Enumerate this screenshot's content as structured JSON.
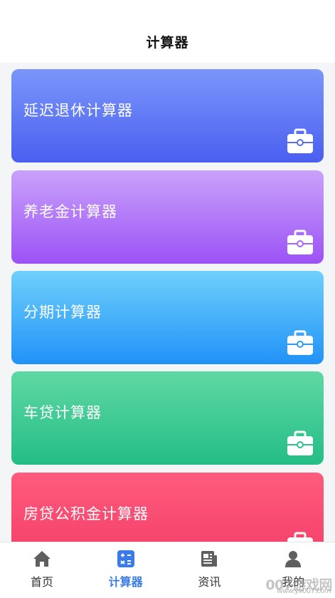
{
  "header": {
    "title": "计算器"
  },
  "cards": [
    {
      "label": "延迟退休计算器",
      "icon": "briefcase-icon"
    },
    {
      "label": "养老金计算器",
      "icon": "briefcase-icon"
    },
    {
      "label": "分期计算器",
      "icon": "briefcase-icon"
    },
    {
      "label": "车贷计算器",
      "icon": "briefcase-icon"
    },
    {
      "label": "房贷公积金计算器",
      "icon": "briefcase-icon"
    }
  ],
  "tabbar": {
    "tabs": [
      {
        "label": "首页",
        "icon": "home-icon",
        "active": false
      },
      {
        "label": "计算器",
        "icon": "calculator-icon",
        "active": true
      },
      {
        "label": "资讯",
        "icon": "news-icon",
        "active": false
      },
      {
        "label": "我的",
        "icon": "user-icon",
        "active": false
      }
    ]
  },
  "watermark": {
    "text": "007游戏网",
    "sub": "www.yx007.com"
  },
  "colors": {
    "accent": "#3a7be8",
    "inactive_icon": "#5f5f5f"
  }
}
